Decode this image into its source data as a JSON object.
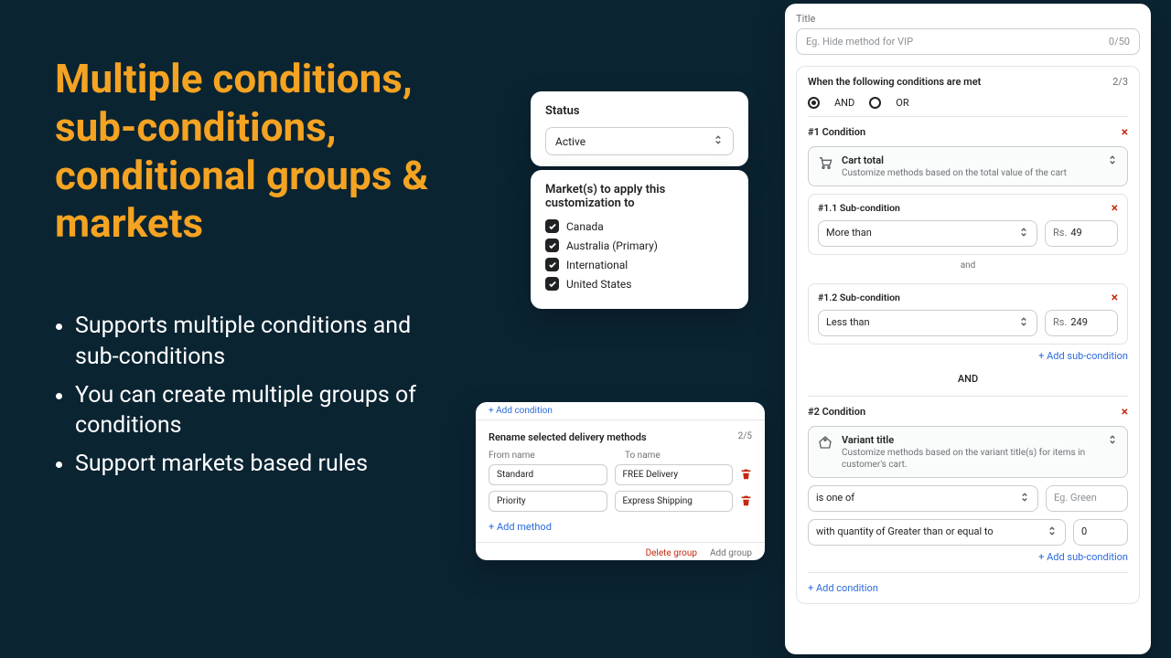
{
  "hero": {
    "title": "Multiple conditions, sub-conditions, conditional groups & markets",
    "bullets": [
      "Supports multiple conditions and sub-conditions",
      "You can create multiple groups of conditions",
      "Support markets based rules"
    ]
  },
  "status": {
    "heading": "Status",
    "value": "Active"
  },
  "markets": {
    "heading": "Market(s) to apply this customization to",
    "items": [
      "Canada",
      "Australia (Primary)",
      "International",
      "United States"
    ]
  },
  "rename": {
    "strip": "+ Add condition",
    "heading": "Rename selected delivery methods",
    "count": "2/5",
    "from_label": "From name",
    "to_label": "To name",
    "rows": [
      {
        "from": "Standard",
        "to": "FREE Delivery"
      },
      {
        "from": "Priority",
        "to": "Express Shipping"
      }
    ],
    "add": "+  Add method",
    "delete_group": "Delete group",
    "add_group": "Add group"
  },
  "cond": {
    "title_label": "Title",
    "title_placeholder": "Eg. Hide method for VIP",
    "title_count": "0/50",
    "when": "When the following conditions are met",
    "when_count": "2/3",
    "and": "AND",
    "or": "OR",
    "add_sub": "+  Add sub-condition",
    "big_and": "AND",
    "and_sep": "and",
    "add_condition": "+  Add condition",
    "c1": {
      "head": "#1 Condition",
      "type_title": "Cart total",
      "type_desc": "Customize methods based on the total value of the cart",
      "s1": {
        "head": "#1.1 Sub-condition",
        "op": "More than",
        "prefix": "Rs.",
        "val": "49"
      },
      "s2": {
        "head": "#1.2 Sub-condition",
        "op": "Less than",
        "prefix": "Rs.",
        "val": "249"
      }
    },
    "c2": {
      "head": "#2 Condition",
      "type_title": "Variant title",
      "type_desc": "Customize methods based on the variant title(s) for items in customer's cart.",
      "op": "is one of",
      "val_placeholder": "Eg. Green",
      "qty_op": "with quantity of Greater than or equal to",
      "qty_val": "0"
    }
  }
}
